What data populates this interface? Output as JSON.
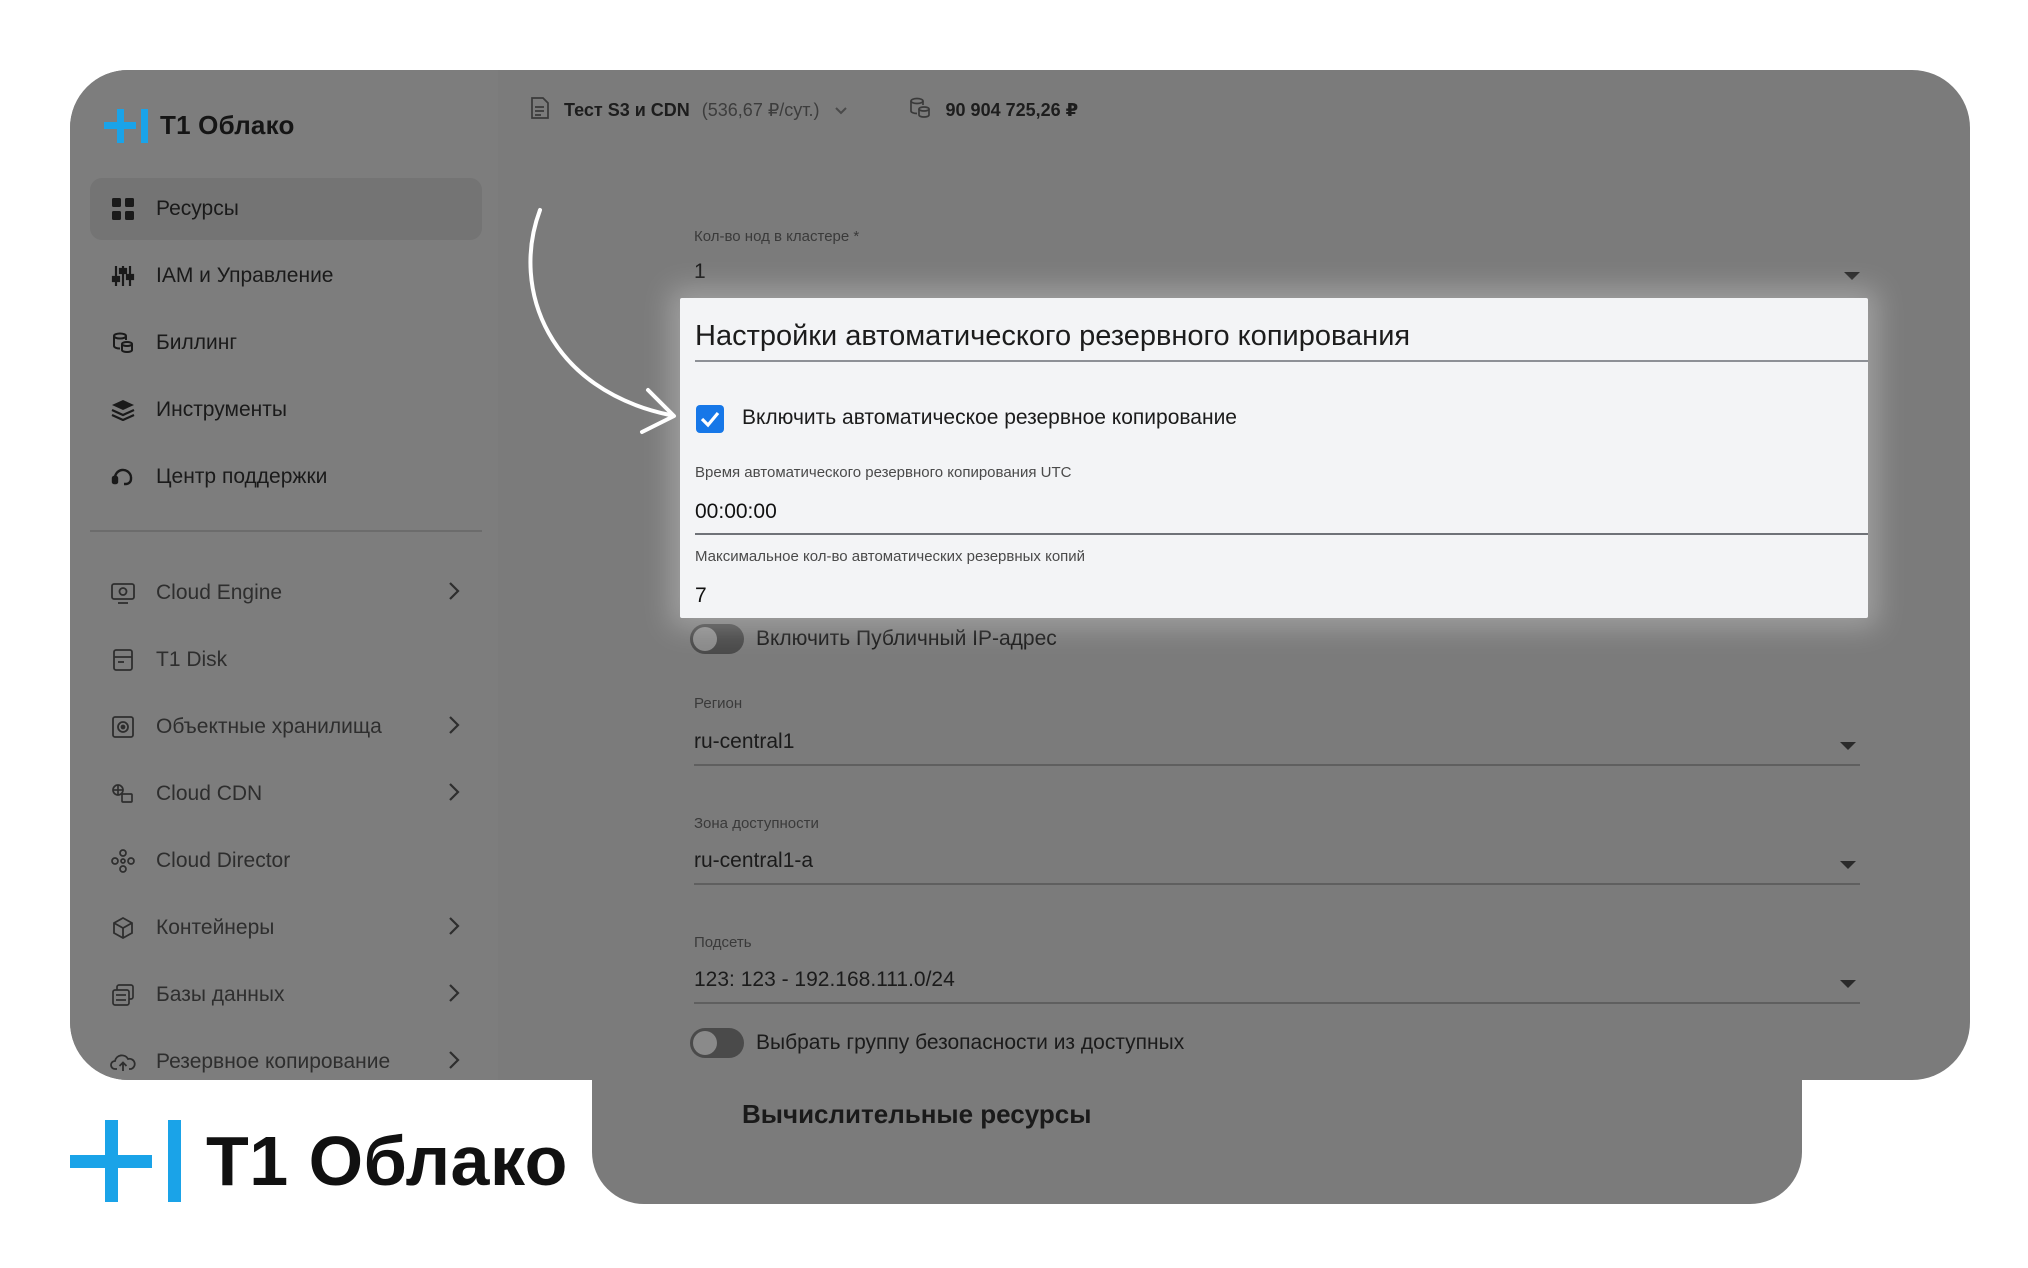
{
  "brand": {
    "name": "T1 Облако",
    "colors": {
      "accent_blue": "#1aa3e8",
      "checkbox_blue": "#1677e8"
    }
  },
  "sidebar": {
    "items": [
      {
        "label": "Ресурсы",
        "icon": "grid-icon",
        "active": true
      },
      {
        "label": "IAM и Управление",
        "icon": "sliders-icon"
      },
      {
        "label": "Биллинг",
        "icon": "coins-icon"
      },
      {
        "label": "Инструменты",
        "icon": "layers-icon"
      },
      {
        "label": "Центр поддержки",
        "icon": "headset-icon"
      }
    ],
    "services": [
      {
        "label": "Cloud Engine",
        "icon": "monitor-icon",
        "chevron": true
      },
      {
        "label": "T1 Disk",
        "icon": "disk-icon",
        "chevron": false
      },
      {
        "label": "Объектные хранилища",
        "icon": "storage-icon",
        "chevron": true
      },
      {
        "label": "Cloud CDN",
        "icon": "cdn-icon",
        "chevron": true
      },
      {
        "label": "Cloud Director",
        "icon": "director-icon",
        "chevron": false
      },
      {
        "label": "Контейнеры",
        "icon": "cube-icon",
        "chevron": true
      },
      {
        "label": "Базы данных",
        "icon": "database-icon",
        "chevron": true
      },
      {
        "label": "Резервное копирование",
        "icon": "cloud-backup-icon",
        "chevron": true
      }
    ]
  },
  "topbar": {
    "project_name": "Тест S3 и CDN",
    "project_rate": "(536,67 ₽/сут.)",
    "balance": "90 904 725,26 ₽"
  },
  "form": {
    "nodes": {
      "label": "Кол-во нод в кластере *",
      "value": "1"
    },
    "public_ip_toggle": {
      "label": "Включить Публичный IP-адрес",
      "on": false
    },
    "region": {
      "label": "Регион",
      "value": "ru-central1"
    },
    "zone": {
      "label": "Зона доступности",
      "value": "ru-central1-a"
    },
    "subnet": {
      "label": "Подсеть",
      "value": "123: 123 - 192.168.111.0/24"
    },
    "security_group_toggle": {
      "label": "Выбрать группу безопасности из доступных",
      "on": false
    },
    "compute_section_title": "Вычислительные ресурсы"
  },
  "backup_panel": {
    "title": "Настройки автоматического резервного копирования",
    "enable_checkbox": {
      "label": "Включить автоматическое резервное копирование",
      "checked": true
    },
    "time": {
      "label": "Время автоматического резервного копирования UTC",
      "value": "00:00:00"
    },
    "max_copies": {
      "label": "Максимальное кол-во автоматических резервных копий",
      "value": "7"
    }
  }
}
